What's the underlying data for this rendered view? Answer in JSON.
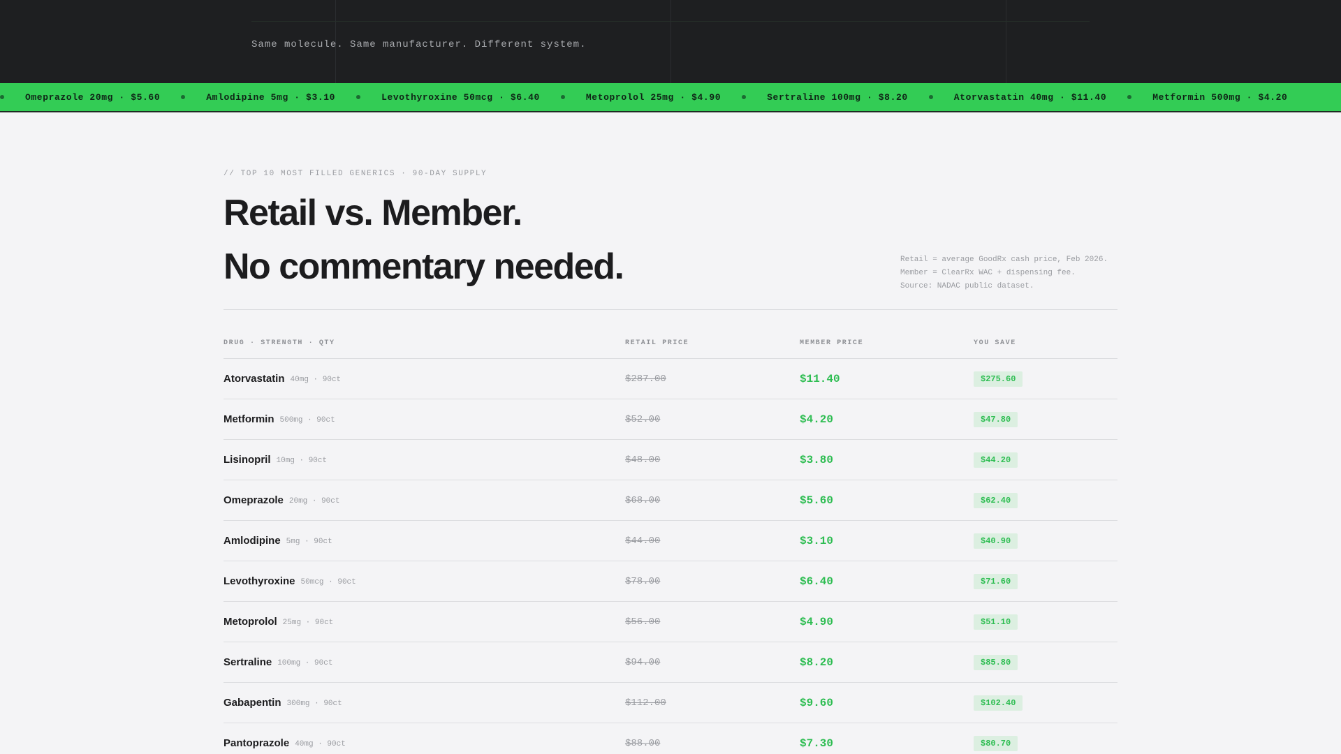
{
  "hero": {
    "tagline": "Same molecule. Same manufacturer. Different system."
  },
  "ticker": {
    "items": [
      "Omeprazole 20mg · $5.60",
      "Amlodipine 5mg · $3.10",
      "Levothyroxine 50mcg · $6.40",
      "Metoprolol 25mg · $4.90",
      "Sertraline 100mg · $8.20",
      "Atorvastatin 40mg · $11.40",
      "Metformin 500mg · $4.20"
    ]
  },
  "main": {
    "eyebrow": "// TOP 10 MOST FILLED GENERICS · 90-DAY SUPPLY",
    "headline_line1": "Retail vs. Member.",
    "headline_line2": "No commentary needed.",
    "footnote": [
      "Retail = average GoodRx cash price, Feb 2026.",
      "Member = ClearRx WAC + dispensing fee.",
      "Source: NADAC public dataset."
    ]
  },
  "table": {
    "headers": {
      "drug": "DRUG · STRENGTH · QTY",
      "retail": "RETAIL PRICE",
      "member": "MEMBER PRICE",
      "save": "YOU SAVE"
    },
    "rows": [
      {
        "name": "Atorvastatin",
        "meta": "40mg · 90ct",
        "retail": "$287.00",
        "member": "$11.40",
        "save": "$275.60"
      },
      {
        "name": "Metformin",
        "meta": "500mg · 90ct",
        "retail": "$52.00",
        "member": "$4.20",
        "save": "$47.80"
      },
      {
        "name": "Lisinopril",
        "meta": "10mg · 90ct",
        "retail": "$48.00",
        "member": "$3.80",
        "save": "$44.20"
      },
      {
        "name": "Omeprazole",
        "meta": "20mg · 90ct",
        "retail": "$68.00",
        "member": "$5.60",
        "save": "$62.40"
      },
      {
        "name": "Amlodipine",
        "meta": "5mg · 90ct",
        "retail": "$44.00",
        "member": "$3.10",
        "save": "$40.90"
      },
      {
        "name": "Levothyroxine",
        "meta": "50mcg · 90ct",
        "retail": "$78.00",
        "member": "$6.40",
        "save": "$71.60"
      },
      {
        "name": "Metoprolol",
        "meta": "25mg · 90ct",
        "retail": "$56.00",
        "member": "$4.90",
        "save": "$51.10"
      },
      {
        "name": "Sertraline",
        "meta": "100mg · 90ct",
        "retail": "$94.00",
        "member": "$8.20",
        "save": "$85.80"
      },
      {
        "name": "Gabapentin",
        "meta": "300mg · 90ct",
        "retail": "$112.00",
        "member": "$9.60",
        "save": "$102.40"
      },
      {
        "name": "Pantoprazole",
        "meta": "40mg · 90ct",
        "retail": "$88.00",
        "member": "$7.30",
        "save": "$80.70"
      }
    ]
  },
  "colors": {
    "accent": "#33cc55",
    "dark": "#1e1f21",
    "page": "#f4f4f6"
  }
}
